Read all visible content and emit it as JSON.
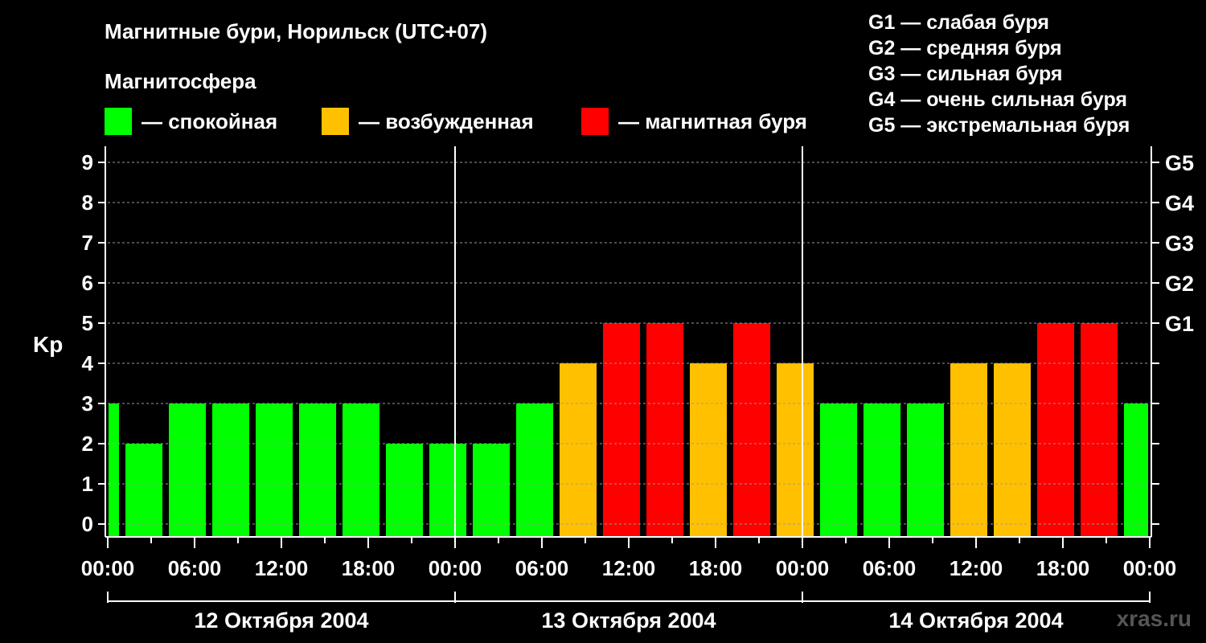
{
  "title": "Магнитные бури, Норильск (UTC+07)",
  "subtitle": "Магнитосфера",
  "legend": [
    {
      "label": "— спокойная",
      "color": "#00ff00"
    },
    {
      "label": "— возбужденная",
      "color": "#ffc000"
    },
    {
      "label": "— магнитная буря",
      "color": "#ff0000"
    }
  ],
  "g_legend": [
    "G1 — слабая буря",
    "G2 — средняя буря",
    "G3 — сильная буря",
    "G4 — очень сильная буря",
    "G5 — экстремальная буря"
  ],
  "watermark": "xras.ru",
  "chart_data": {
    "type": "bar",
    "ylabel": "Kp",
    "ylim": [
      0,
      9
    ],
    "y_ticks": [
      "0",
      "1",
      "2",
      "3",
      "4",
      "5",
      "6",
      "7",
      "8",
      "9"
    ],
    "right_ticks": [
      {
        "kp": 5,
        "label": "G1"
      },
      {
        "kp": 6,
        "label": "G2"
      },
      {
        "kp": 7,
        "label": "G3"
      },
      {
        "kp": 8,
        "label": "G4"
      },
      {
        "kp": 9,
        "label": "G5"
      }
    ],
    "x_tick_labels": [
      "00:00",
      "06:00",
      "12:00",
      "18:00",
      "00:00",
      "06:00",
      "12:00",
      "18:00",
      "00:00",
      "06:00",
      "12:00",
      "18:00",
      "00:00"
    ],
    "x_tick_hours": [
      0,
      6,
      12,
      18,
      24,
      30,
      36,
      42,
      48,
      54,
      60,
      66,
      72
    ],
    "days": [
      "12 Октября 2004",
      "13 Октября 2004",
      "14 Октября 2004"
    ],
    "grid": "dashed horizontal",
    "bars": [
      {
        "start_hour": 0,
        "end_hour": 1,
        "kp": 3
      },
      {
        "start_hour": 1,
        "end_hour": 4,
        "kp": 2
      },
      {
        "start_hour": 4,
        "end_hour": 7,
        "kp": 3
      },
      {
        "start_hour": 7,
        "end_hour": 10,
        "kp": 3
      },
      {
        "start_hour": 10,
        "end_hour": 13,
        "kp": 3
      },
      {
        "start_hour": 13,
        "end_hour": 16,
        "kp": 3
      },
      {
        "start_hour": 16,
        "end_hour": 19,
        "kp": 3
      },
      {
        "start_hour": 19,
        "end_hour": 22,
        "kp": 2
      },
      {
        "start_hour": 22,
        "end_hour": 25,
        "kp": 2
      },
      {
        "start_hour": 25,
        "end_hour": 28,
        "kp": 2
      },
      {
        "start_hour": 28,
        "end_hour": 31,
        "kp": 3
      },
      {
        "start_hour": 31,
        "end_hour": 34,
        "kp": 4
      },
      {
        "start_hour": 34,
        "end_hour": 37,
        "kp": 5
      },
      {
        "start_hour": 37,
        "end_hour": 40,
        "kp": 5
      },
      {
        "start_hour": 40,
        "end_hour": 43,
        "kp": 4
      },
      {
        "start_hour": 43,
        "end_hour": 46,
        "kp": 5
      },
      {
        "start_hour": 46,
        "end_hour": 49,
        "kp": 4
      },
      {
        "start_hour": 49,
        "end_hour": 52,
        "kp": 3
      },
      {
        "start_hour": 52,
        "end_hour": 55,
        "kp": 3
      },
      {
        "start_hour": 55,
        "end_hour": 58,
        "kp": 3
      },
      {
        "start_hour": 58,
        "end_hour": 61,
        "kp": 4
      },
      {
        "start_hour": 61,
        "end_hour": 64,
        "kp": 4
      },
      {
        "start_hour": 64,
        "end_hour": 67,
        "kp": 5
      },
      {
        "start_hour": 67,
        "end_hour": 70,
        "kp": 5
      },
      {
        "start_hour": 70,
        "end_hour": 72,
        "kp": 3
      }
    ]
  }
}
